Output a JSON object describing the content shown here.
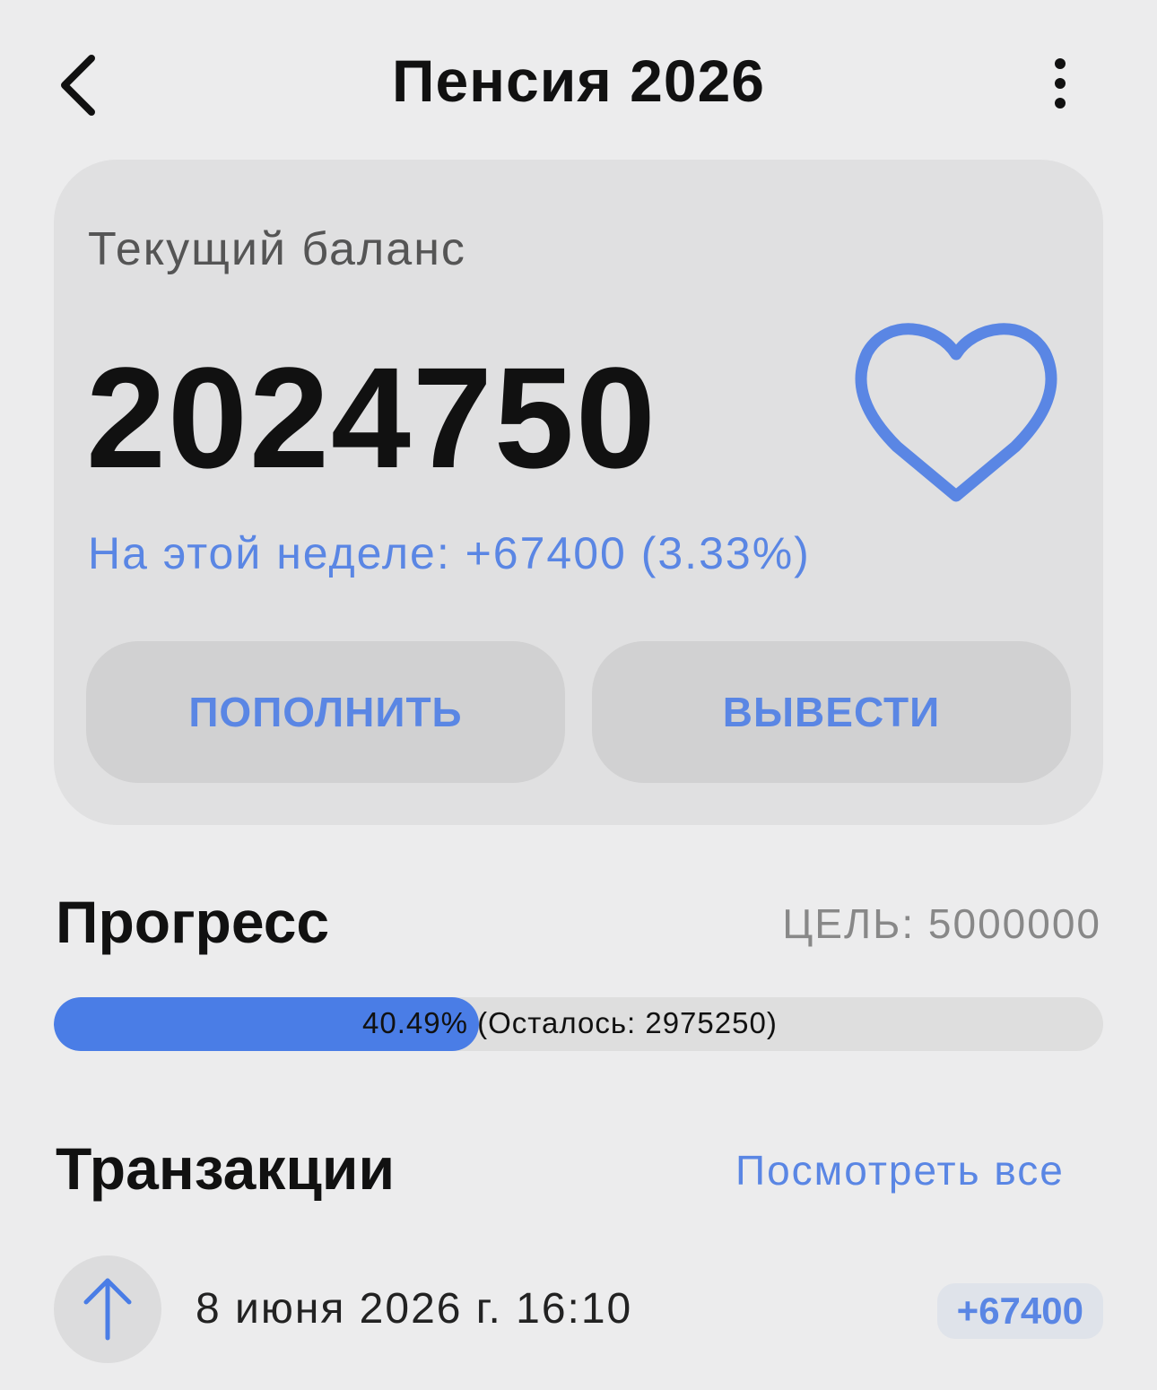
{
  "header": {
    "title": "Пенсия 2026",
    "back_icon": "chevron-left-icon",
    "more_icon": "more-vertical-icon"
  },
  "balance_card": {
    "label": "Текущий баланс",
    "value": "2024750",
    "favorite_icon": "heart-outline-icon",
    "week_change": "На этой неделе: +67400 (3.33%)",
    "deposit_label": "ПОПОЛНИТЬ",
    "withdraw_label": "ВЫВЕСТИ"
  },
  "progress": {
    "title": "Прогресс",
    "goal": "ЦЕЛЬ: 5000000",
    "fraction": 0.4049,
    "text": "40.49% (Осталось: 2975250)"
  },
  "transactions": {
    "title": "Транзакции",
    "see_all": "Посмотреть все",
    "items": [
      {
        "icon": "arrow-up-icon",
        "date": "8 июня 2026 г. 16:10",
        "amount": "+67400"
      }
    ]
  },
  "colors": {
    "accent": "#5a86e4",
    "progress_fill": "#4a7de6",
    "background": "#ececed",
    "card": "#e0e0e1"
  }
}
